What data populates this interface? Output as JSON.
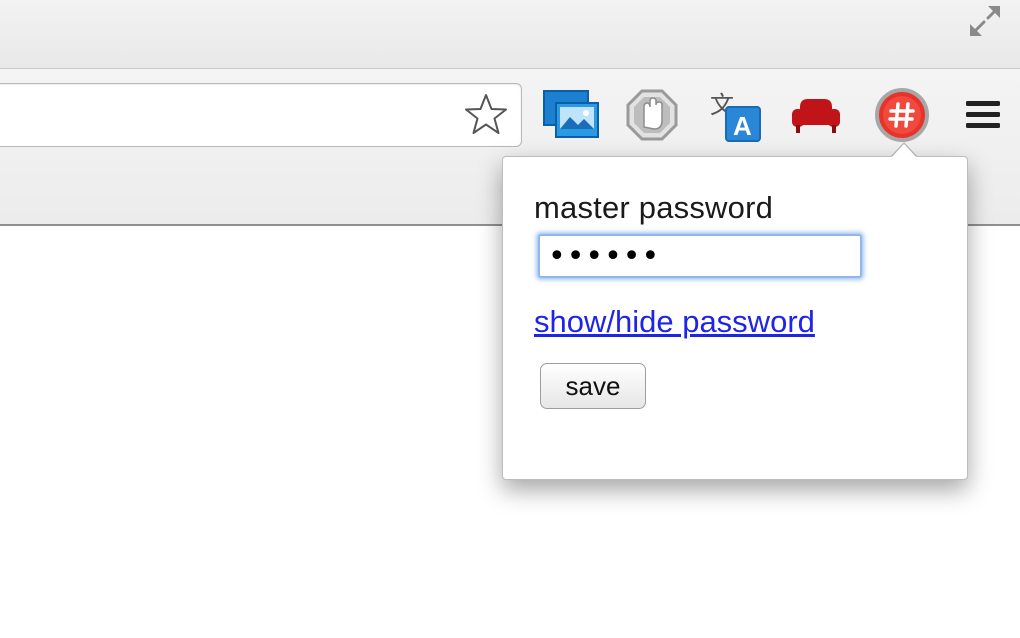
{
  "toolbar": {
    "extensions": [
      {
        "icon": "image-viewer-icon"
      },
      {
        "icon": "stop-hand-icon"
      },
      {
        "icon": "translate-icon"
      },
      {
        "icon": "armchair-icon"
      },
      {
        "icon": "hash-password-icon"
      }
    ],
    "menu_icon": "hamburger-menu-icon"
  },
  "popup": {
    "label": "master password",
    "password_value": "123456",
    "toggle_link": "show/hide password",
    "save_label": "save"
  },
  "colors": {
    "link": "#1e24e8",
    "focus_ring": "#8fb7ec",
    "hash_red": "#e8332a",
    "armchair_red": "#c0141a"
  }
}
